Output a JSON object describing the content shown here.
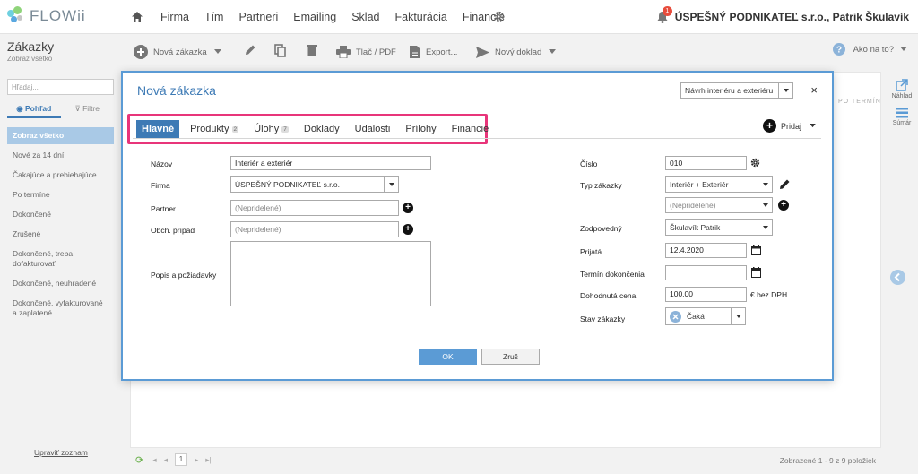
{
  "app": {
    "logo_text": "FLOWii"
  },
  "nav": {
    "links": [
      "Firma",
      "Tím",
      "Partneri",
      "Emailing",
      "Sklad",
      "Fakturácia",
      "Financie"
    ],
    "notification_count": "1",
    "user": "ÚSPEŠNÝ PODNIKATEĽ s.r.o., Patrik Škulavík"
  },
  "toolbar": {
    "title": "Zákazky",
    "subtitle": "Zobraz všetko",
    "new_order": "Nová zákazka",
    "print": "Tlač / PDF",
    "export": "Export...",
    "new_doc": "Nový doklad",
    "help": "Ako na to?"
  },
  "sidebar": {
    "search_placeholder": "Hľadaj...",
    "view_tab": "Pohľad",
    "filter_tab": "Filtre",
    "items": [
      "Zobraz všetko",
      "Nové za 14 dní",
      "Čakajúce a prebiehajúce",
      "Po termíne",
      "Dokončené",
      "Zrušené",
      "Dokončené, treba dofakturovať",
      "Dokončené, neuhradené",
      "Dokončené, vyfakturované a zaplatené"
    ],
    "edit_list": "Upraviť zoznam"
  },
  "main": {
    "column_hint": "PO TERMÍN",
    "page": "1",
    "count": "Zobrazené 1 - 9 z 9 položiek"
  },
  "right_rail": {
    "preview": "Náhľad",
    "summary": "Súmár"
  },
  "modal": {
    "title": "Nová zákazka",
    "template_select": "Návrh interiéru a exteriéru",
    "close": "×",
    "tabs": [
      {
        "label": "Hlavné",
        "count": ""
      },
      {
        "label": "Produkty",
        "count": "2"
      },
      {
        "label": "Úlohy",
        "count": "7"
      },
      {
        "label": "Doklady",
        "count": ""
      },
      {
        "label": "Udalosti",
        "count": ""
      },
      {
        "label": "Prílohy",
        "count": ""
      },
      {
        "label": "Financie",
        "count": ""
      }
    ],
    "add_label": "Pridaj",
    "left": {
      "name_label": "Názov",
      "name_value": "Interiér a exteriér",
      "company_label": "Firma",
      "company_value": "ÚSPEŠNÝ PODNIKATEĽ s.r.o.",
      "partner_label": "Partner",
      "partner_placeholder": "(Nepridelené)",
      "case_label": "Obch. prípad",
      "case_placeholder": "(Nepridelené)",
      "desc_label": "Popis a požiadavky"
    },
    "right": {
      "number_label": "Číslo",
      "number_value": "010",
      "type_label": "Typ zákazky",
      "type_value": "Interiér + Exteriér",
      "type2_placeholder": "(Nepridelené)",
      "owner_label": "Zodpovedný",
      "owner_value": "Škulavík Patrik",
      "received_label": "Prijatá",
      "received_value": "12.4.2020",
      "deadline_label": "Termín dokončenia",
      "deadline_value": "",
      "price_label": "Dohodnutá cena",
      "price_value": "100,00",
      "price_unit": "€ bez DPH",
      "status_label": "Stav zákazky",
      "status_value": "Čaká"
    },
    "ok": "OK",
    "cancel": "Zruš"
  },
  "colors": {
    "accent": "#3d7ab5",
    "highlight": "#e8357a",
    "active_sidebar": "#a9c9e6"
  }
}
